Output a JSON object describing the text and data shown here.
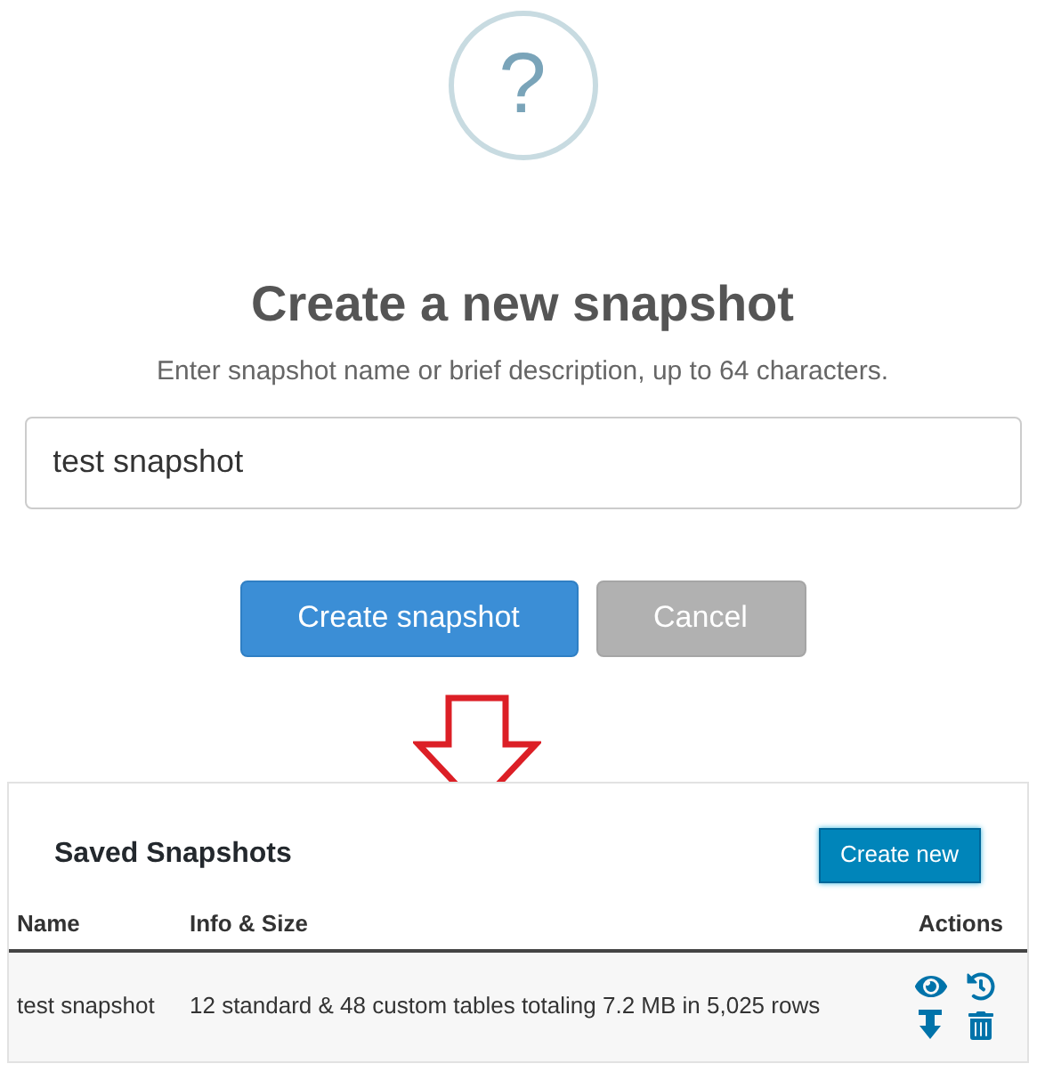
{
  "help_glyph": "?",
  "title": "Create a new snapshot",
  "subtitle": "Enter snapshot name or brief description, up to 64 characters.",
  "name_field": {
    "value": "test snapshot"
  },
  "buttons": [
    {
      "label": "Create snapshot",
      "kind": "primary"
    },
    {
      "label": "Cancel",
      "kind": "secondary"
    }
  ],
  "saved": {
    "title": "Saved Snapshots",
    "create_button": "Create new",
    "columns": [
      "Name",
      "Info & Size",
      "Actions"
    ],
    "rows": [
      {
        "name": "test snapshot",
        "info": "12 standard & 48 custom tables totaling 7.2 MB in 5,025 rows"
      }
    ]
  }
}
